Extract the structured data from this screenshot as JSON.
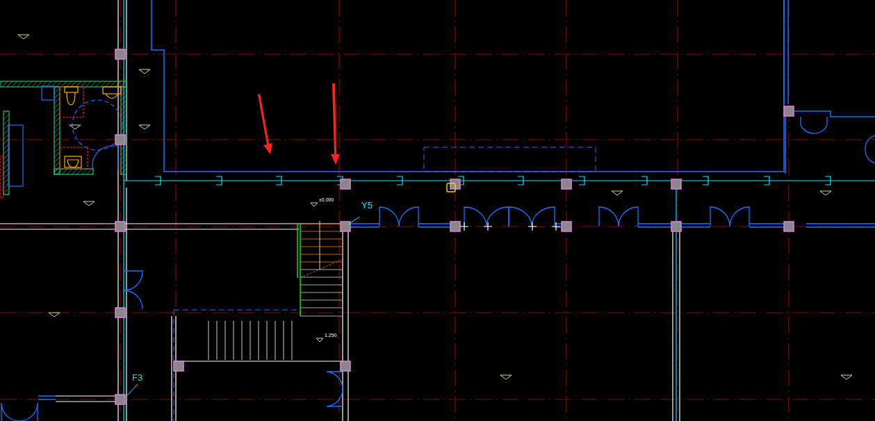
{
  "viewport": {
    "labels": [
      {
        "kind": "axis_tag",
        "text": "Y5"
      },
      {
        "kind": "axis_tag",
        "text": "F3"
      },
      {
        "kind": "elevation",
        "text": "±0.000"
      },
      {
        "kind": "elevation",
        "text": "1.250"
      }
    ]
  }
}
